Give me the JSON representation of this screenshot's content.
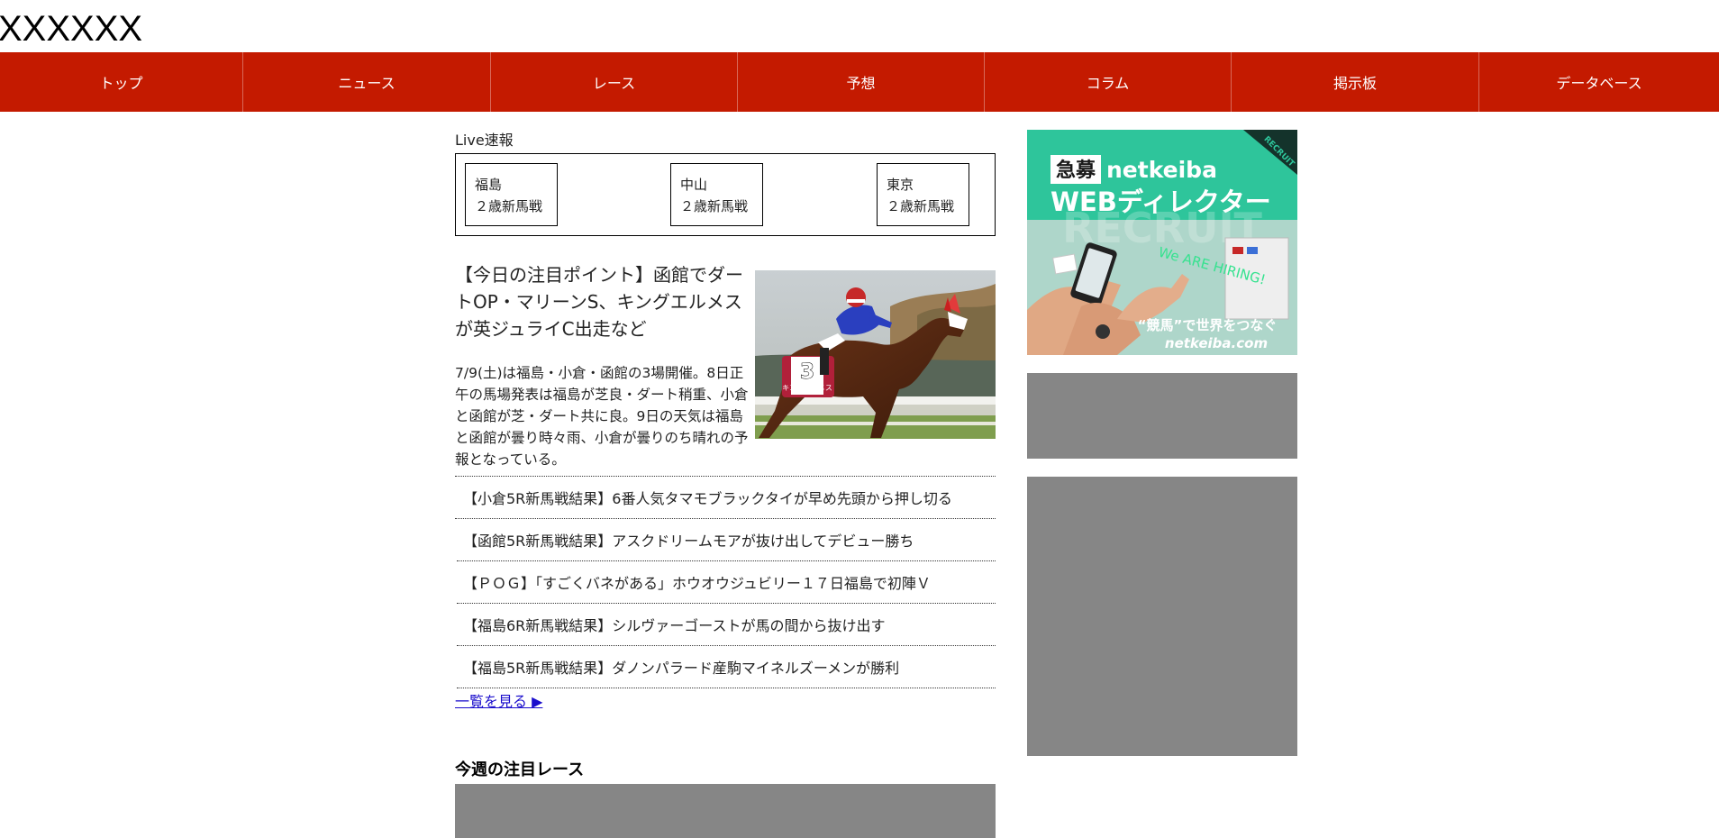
{
  "site": {
    "logo": "XXXXXX"
  },
  "nav": {
    "items": [
      {
        "label": "トップ"
      },
      {
        "label": "ニュース"
      },
      {
        "label": "レース"
      },
      {
        "label": "予想"
      },
      {
        "label": "コラム"
      },
      {
        "label": "掲示板"
      },
      {
        "label": "データベース"
      }
    ],
    "background_color": "#c41a00"
  },
  "live": {
    "title": "Live速報",
    "cards": [
      {
        "venue": "福島",
        "race": "２歳新馬戦"
      },
      {
        "venue": "中山",
        "race": "２歳新馬戦"
      },
      {
        "venue": "東京",
        "race": "２歳新馬戦"
      }
    ]
  },
  "feature": {
    "title": "【今日の注目ポイント】函館でダートOP・マリーンS、キングエルメスが英ジュライC出走など",
    "body": "7/9(土)は福島・小倉・函館の3場開催。8日正午の馬場発表は福島が芝良・ダート稍重、小倉と函館が芝・ダート共に良。9日の天気は福島と函館が曇り時々雨、小倉が曇りのち晴れの予報となっている。",
    "photo": {
      "saddle_number": "3",
      "saddle_name": "キングエルメス"
    }
  },
  "news": {
    "items": [
      {
        "title": "【小倉5R新馬戦結果】6番人気タマモブラックタイが早め先頭から押し切る"
      },
      {
        "title": "【函館5R新馬戦結果】アスクドリームモアが抜け出してデビュー勝ち"
      },
      {
        "title": "【ＰＯＧ】「すごくバネがある」ホウオウジュビリー１７日福島で初陣Ｖ"
      },
      {
        "title": "【福島6R新馬戦結果】シルヴァーゴーストが馬の間から抜け出す"
      },
      {
        "title": "【福島5R新馬戦結果】ダノンパラード産駒マイネルズーメンが勝利"
      }
    ],
    "more_label": "一覧を見る ▶"
  },
  "weekly": {
    "heading": "今週の注目レース"
  },
  "sidebar": {
    "recruit_ad": {
      "badge": "急募",
      "brand": "netkeiba",
      "headline": "WEBディレクター",
      "ribbon": "RECRUIT",
      "watermark": "RECRUIT",
      "tagline": "“競馬”で世界をつなぐ",
      "footer_brand": "netkeiba.com",
      "handwriting": "We ARE HIRING!",
      "background_color": "#2ec59b"
    }
  }
}
